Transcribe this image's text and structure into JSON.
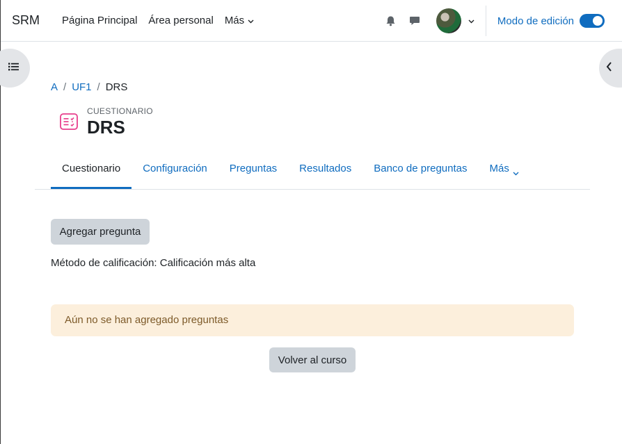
{
  "navbar": {
    "brand": "SRM",
    "links": [
      "Página Principal",
      "Área personal",
      "Más"
    ],
    "edit_mode_label": "Modo de edición",
    "edit_mode_on": true
  },
  "breadcrumb": [
    "A",
    "UF1",
    "DRS"
  ],
  "header": {
    "activity_type": "CUESTIONARIO",
    "title": "DRS"
  },
  "tabs": [
    "Cuestionario",
    "Configuración",
    "Preguntas",
    "Resultados",
    "Banco de preguntas",
    "Más"
  ],
  "active_tab": "Cuestionario",
  "main": {
    "add_question_label": "Agregar pregunta",
    "grading_method": "Método de calificación: Calificación más alta",
    "alert": "Aún no se han agregado preguntas",
    "back_label": "Volver al curso"
  },
  "colors": {
    "link": "#0f6cbf",
    "button_secondary": "#ced4da",
    "alert_bg": "#fcefdc",
    "activity_icon": "#e83e8c"
  }
}
